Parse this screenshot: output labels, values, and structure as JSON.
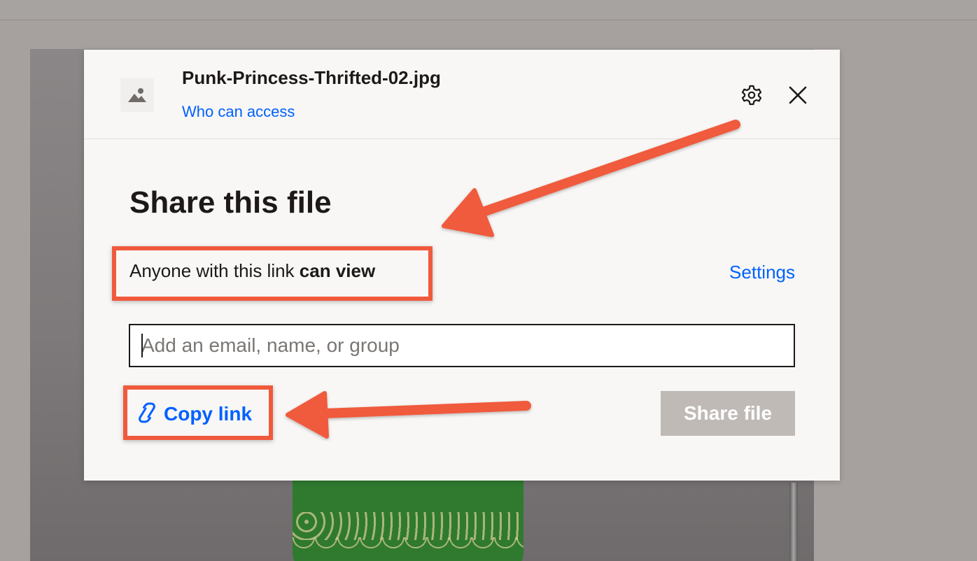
{
  "file": {
    "name": "Punk-Princess-Thrifted-02.jpg",
    "access_link": "Who can access",
    "thumb_icon": "image-icon"
  },
  "header_icons": {
    "settings_icon": "gear-icon",
    "close_icon": "close-icon"
  },
  "share": {
    "title": "Share this file",
    "access_prefix": "Anyone with this link ",
    "access_permission": "can view",
    "settings_label": "Settings",
    "invite_placeholder": "Add an email, name, or group",
    "copy_link_label": "Copy link",
    "copy_link_icon": "link-icon",
    "share_button_label": "Share file"
  },
  "colors": {
    "accent_blue": "#0061fe",
    "annotation_red": "#f05a3c",
    "disabled_button": "#bfbab6"
  }
}
